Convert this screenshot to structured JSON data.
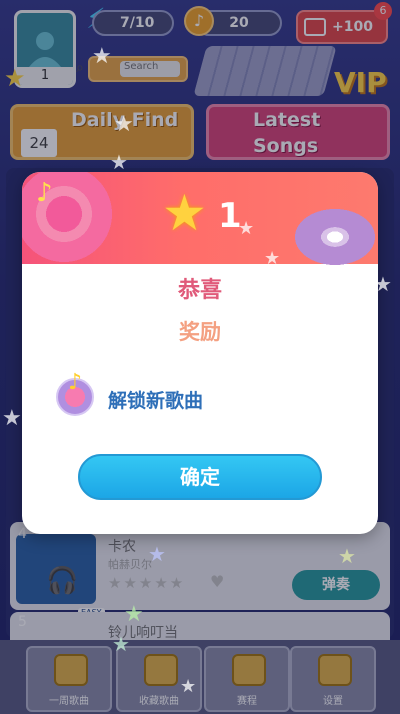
{
  "header": {
    "avatar_level": "1",
    "energy": "7/10",
    "coins": "20",
    "video_reward": "+100",
    "notification_count": "6",
    "search_placeholder": "Search",
    "vip_label": "VIP"
  },
  "features": {
    "daily_find_label": "Daily Find",
    "daily_find_day": "24",
    "latest_songs_label": "Latest Songs"
  },
  "song_list": [
    {
      "index": "4",
      "title": "卡农",
      "artist": "帕赫贝尔",
      "difficulty": "EASY",
      "play_label": "弹奏"
    },
    {
      "index": "5",
      "title": "铃儿响叮当"
    }
  ],
  "bottom_nav": [
    {
      "label": "一周歌曲"
    },
    {
      "label": "收藏歌曲"
    },
    {
      "label": "赛程"
    },
    {
      "label": "设置"
    }
  ],
  "modal": {
    "star_count": "1",
    "congrats_text": "恭喜",
    "reward_text": "奖励",
    "reward_item": "解锁新歌曲",
    "confirm_label": "确定"
  },
  "colors": {
    "modal_header_start": "#f5537a",
    "modal_header_end": "#fd7a6e",
    "confirm_button": "#1ca6e6",
    "congrats_text": "#e05a7a",
    "reward_title": "#f4a081",
    "reward_item_text": "#2e6fb8"
  },
  "icons": {
    "energy": "lightning-icon",
    "coin": "music-coin-icon",
    "video": "video-icon",
    "search": "search-icon",
    "star": "star-icon",
    "note": "music-note-icon",
    "lock": "lock-icon"
  }
}
